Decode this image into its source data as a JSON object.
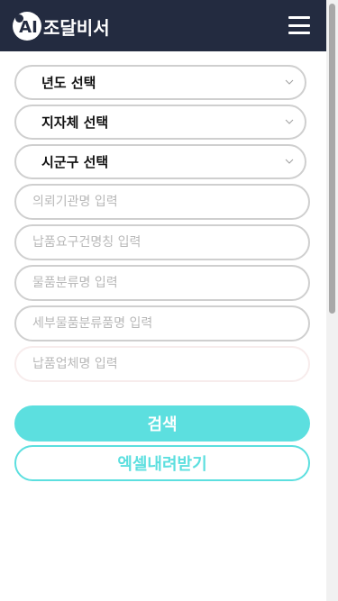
{
  "header": {
    "logo_mark": "AI",
    "logo_text": "조달비서",
    "menu_icon": "hamburger-icon"
  },
  "form": {
    "selects": [
      {
        "label": "년도 선택",
        "icon": "chevron-down-icon"
      },
      {
        "label": "지자체 선택",
        "icon": "chevron-down-icon"
      },
      {
        "label": "시군구 선택",
        "icon": "chevron-down-icon"
      }
    ],
    "inputs": [
      {
        "placeholder": "의뢰기관명 입력",
        "value": ""
      },
      {
        "placeholder": "납품요구건명칭 입력",
        "value": ""
      },
      {
        "placeholder": "물품분류명 입력",
        "value": ""
      },
      {
        "placeholder": "세부물품분류품명 입력",
        "value": ""
      },
      {
        "placeholder": "납품업체명 입력",
        "value": ""
      }
    ]
  },
  "buttons": {
    "search": "검색",
    "excel": "엑셀내려받기"
  },
  "colors": {
    "header_bg": "#232b40",
    "accent": "#5cdfdf",
    "field_border": "#cfcfcf"
  }
}
